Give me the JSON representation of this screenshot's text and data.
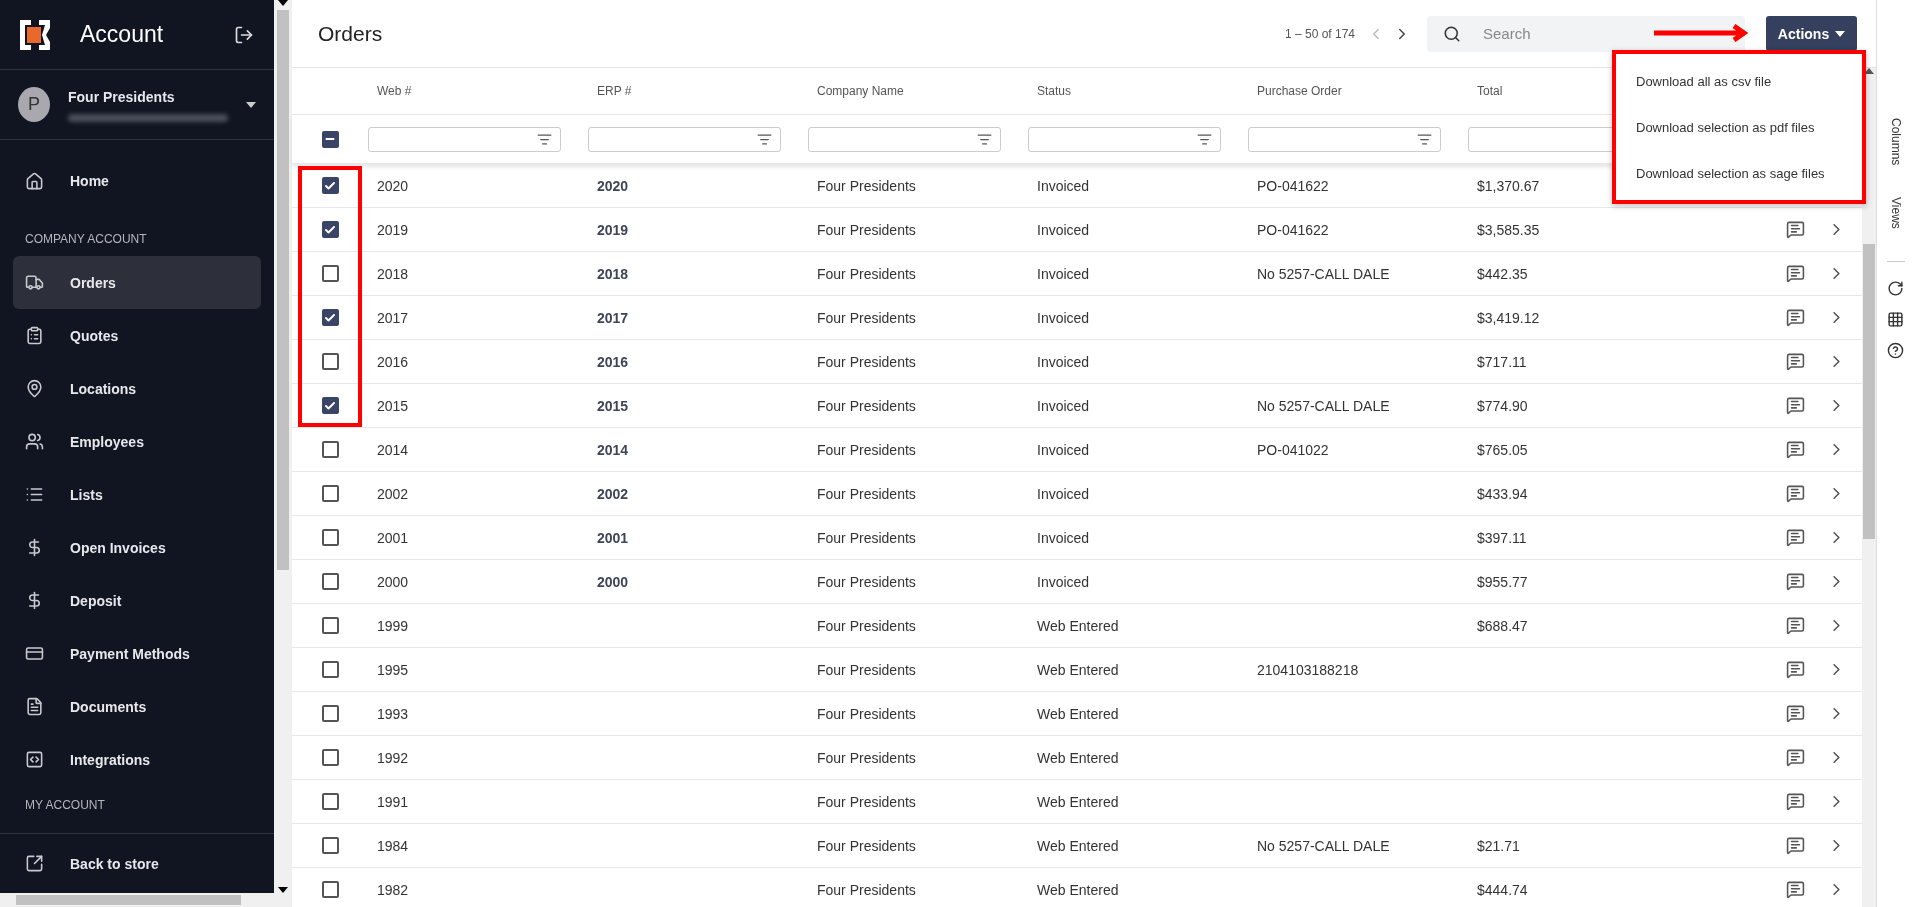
{
  "sidebar": {
    "title": "Account",
    "user": {
      "initial": "P",
      "name": "Four Presidents"
    },
    "items": [
      {
        "kind": "link",
        "label": "Home",
        "selected": false
      },
      {
        "kind": "heading",
        "label": "COMPANY ACCOUNT"
      },
      {
        "kind": "link",
        "label": "Orders",
        "selected": true
      },
      {
        "kind": "link",
        "label": "Quotes",
        "selected": false
      },
      {
        "kind": "link",
        "label": "Locations",
        "selected": false
      },
      {
        "kind": "link",
        "label": "Employees",
        "selected": false
      },
      {
        "kind": "link",
        "label": "Lists",
        "selected": false
      },
      {
        "kind": "link",
        "label": "Open Invoices",
        "selected": false
      },
      {
        "kind": "link",
        "label": "Deposit",
        "selected": false
      },
      {
        "kind": "link",
        "label": "Payment Methods",
        "selected": false
      },
      {
        "kind": "link",
        "label": "Documents",
        "selected": false
      },
      {
        "kind": "link",
        "label": "Integrations",
        "selected": false
      },
      {
        "kind": "heading",
        "label": "MY ACCOUNT"
      }
    ],
    "footer_link": "Back to store"
  },
  "header": {
    "title": "Orders",
    "pagination": {
      "range": "1 – 50 of 174",
      "prev_disabled": true,
      "next_disabled": false
    },
    "search": {
      "placeholder": "Search"
    },
    "actions_button": "Actions"
  },
  "actions_menu": [
    "Download all as csv file",
    "Download selection as pdf files",
    "Download selection as sage files"
  ],
  "table": {
    "columns": [
      "Web #",
      "ERP #",
      "Company Name",
      "Status",
      "Purchase Order",
      "Total"
    ],
    "select_all": {
      "indeterminate": true
    },
    "rows": [
      {
        "web": "2020",
        "erp": "2020",
        "company": "Four Presidents",
        "status": "Invoiced",
        "po": "PO-041622",
        "total": "$1,370.67",
        "checked": true
      },
      {
        "web": "2019",
        "erp": "2019",
        "company": "Four Presidents",
        "status": "Invoiced",
        "po": "PO-041622",
        "total": "$3,585.35",
        "checked": true
      },
      {
        "web": "2018",
        "erp": "2018",
        "company": "Four Presidents",
        "status": "Invoiced",
        "po": "No 5257-CALL DALE",
        "total": "$442.35",
        "checked": false
      },
      {
        "web": "2017",
        "erp": "2017",
        "company": "Four Presidents",
        "status": "Invoiced",
        "total": "$3,419.12",
        "checked": true
      },
      {
        "web": "2016",
        "erp": "2016",
        "company": "Four Presidents",
        "status": "Invoiced",
        "total": "$717.11",
        "checked": false
      },
      {
        "web": "2015",
        "erp": "2015",
        "company": "Four Presidents",
        "status": "Invoiced",
        "po": "No 5257-CALL DALE",
        "total": "$774.90",
        "checked": true
      },
      {
        "web": "2014",
        "erp": "2014",
        "company": "Four Presidents",
        "status": "Invoiced",
        "po": "PO-041022",
        "total": "$765.05",
        "checked": false
      },
      {
        "web": "2002",
        "erp": "2002",
        "company": "Four Presidents",
        "status": "Invoiced",
        "total": "$433.94",
        "checked": false
      },
      {
        "web": "2001",
        "erp": "2001",
        "company": "Four Presidents",
        "status": "Invoiced",
        "total": "$397.11",
        "checked": false
      },
      {
        "web": "2000",
        "erp": "2000",
        "company": "Four Presidents",
        "status": "Invoiced",
        "total": "$955.77",
        "checked": false
      },
      {
        "web": "1999",
        "company": "Four Presidents",
        "status": "Web Entered",
        "total": "$688.47",
        "checked": false
      },
      {
        "web": "1995",
        "company": "Four Presidents",
        "status": "Web Entered",
        "po": "2104103188218",
        "checked": false
      },
      {
        "web": "1993",
        "company": "Four Presidents",
        "status": "Web Entered",
        "checked": false
      },
      {
        "web": "1992",
        "company": "Four Presidents",
        "status": "Web Entered",
        "checked": false
      },
      {
        "web": "1991",
        "company": "Four Presidents",
        "status": "Web Entered",
        "checked": false
      },
      {
        "web": "1984",
        "company": "Four Presidents",
        "status": "Web Entered",
        "po": "No 5257-CALL DALE",
        "total": "$21.71",
        "checked": false
      },
      {
        "web": "1982",
        "company": "Four Presidents",
        "status": "Web Entered",
        "total": "$444.74",
        "checked": false
      }
    ]
  },
  "right_rail": {
    "tabs": [
      "Columns",
      "Views"
    ]
  }
}
